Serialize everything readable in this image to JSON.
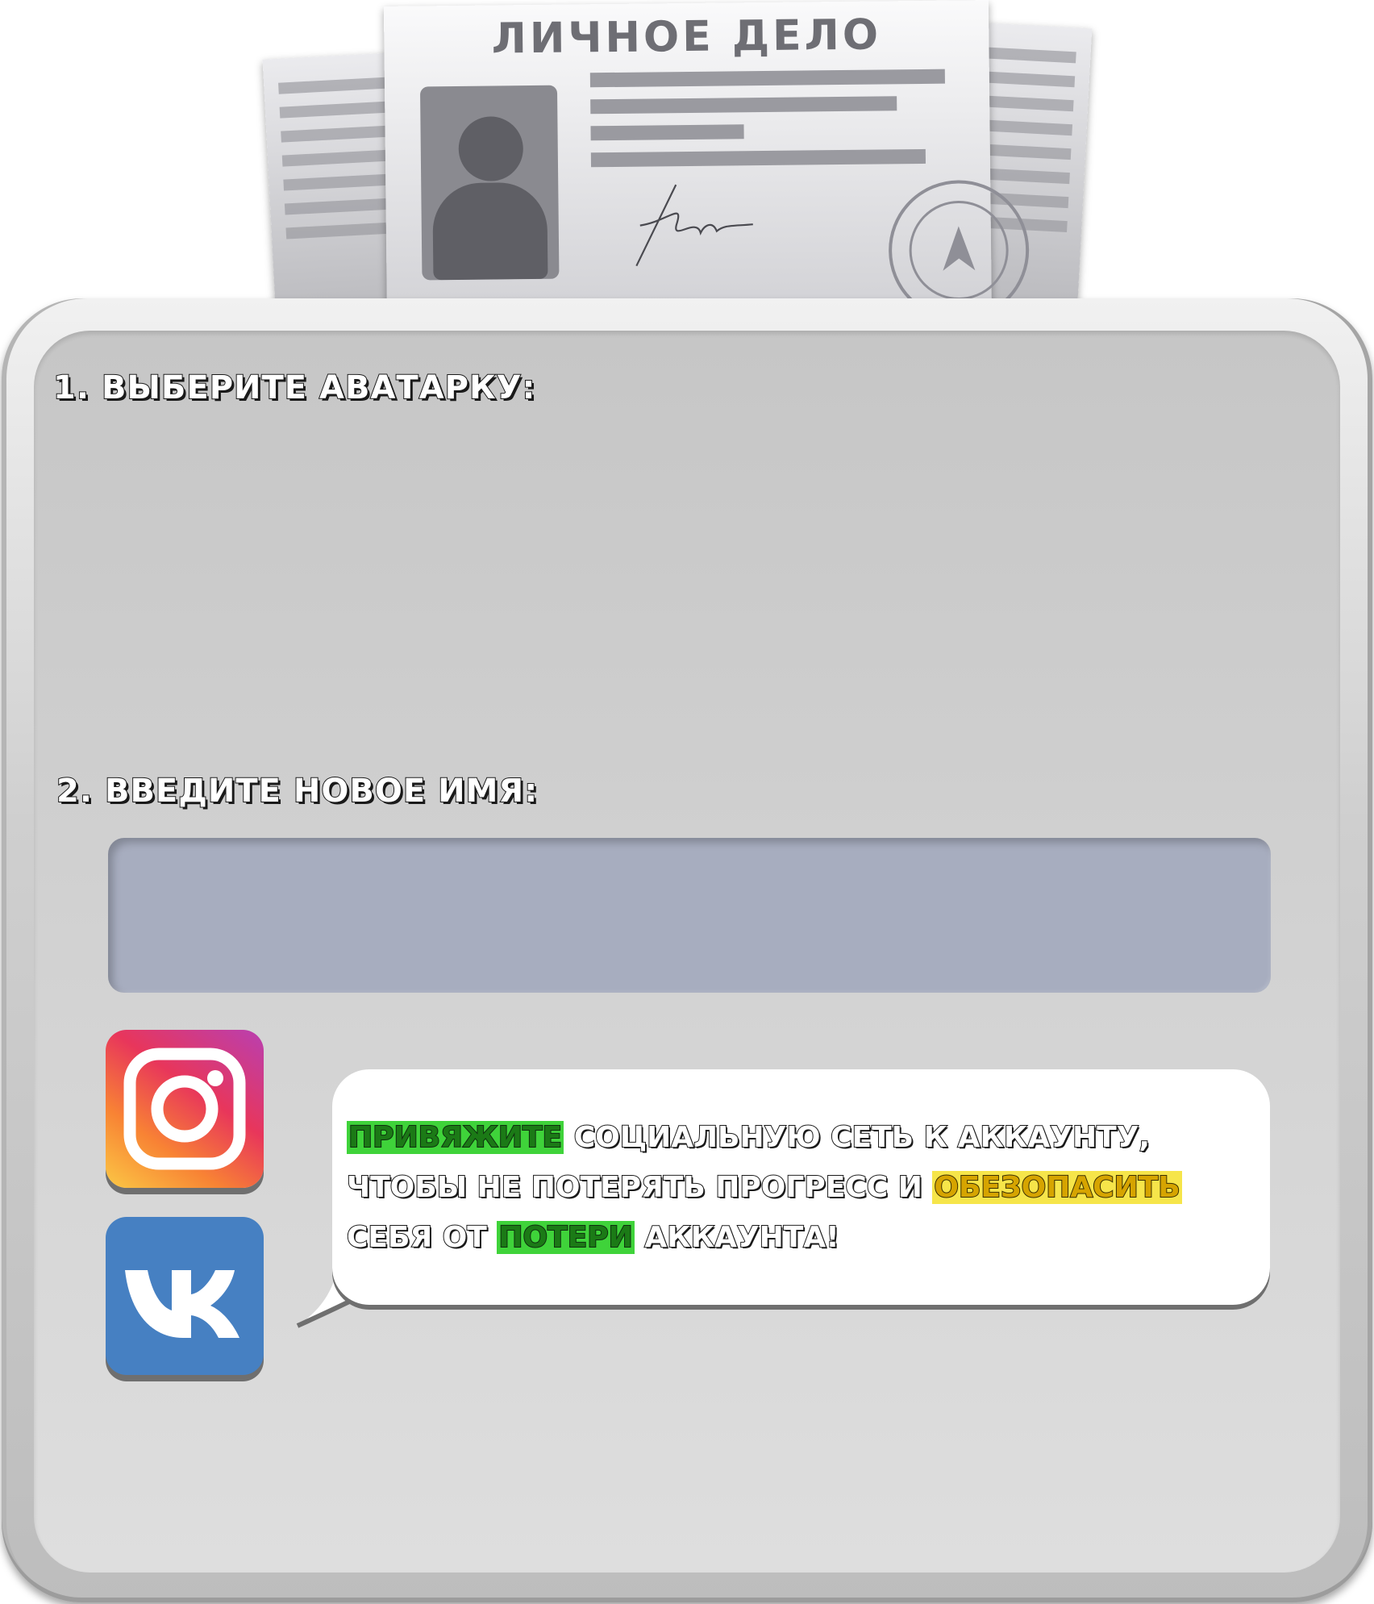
{
  "dossier": {
    "title": "ЛИЧНОЕ ДЕЛО"
  },
  "sections": {
    "avatar_heading": "1. ВЫБЕРИТЕ АВАТАРКУ:",
    "name_heading": "2. ВВЕДИТЕ НОВОЕ ИМЯ:"
  },
  "name_input": {
    "value": "",
    "placeholder": ""
  },
  "social": {
    "instagram_icon": "instagram-icon",
    "vk_icon": "vk-icon",
    "vk_glyph": "VK"
  },
  "bubble": {
    "seg1_green": "ПРИВЯЖИТЕ",
    "seg2": " СОЦИАЛЬНУЮ СЕТЬ К АККАУНТУ, ЧТОБЫ НЕ ПОТЕРЯТЬ ПРОГРЕСС И ",
    "seg3_yellow": "ОБЕЗОПАСИТЬ",
    "seg4": " СЕБЯ ОТ ",
    "seg5_green": "ПОТЕРИ",
    "seg6": " АККАУНТА!"
  },
  "colors": {
    "highlight_green": "#3fd33a",
    "highlight_yellow": "#f6e54a",
    "vk_blue": "#4680c2",
    "input_bg": "#a7adbf"
  }
}
